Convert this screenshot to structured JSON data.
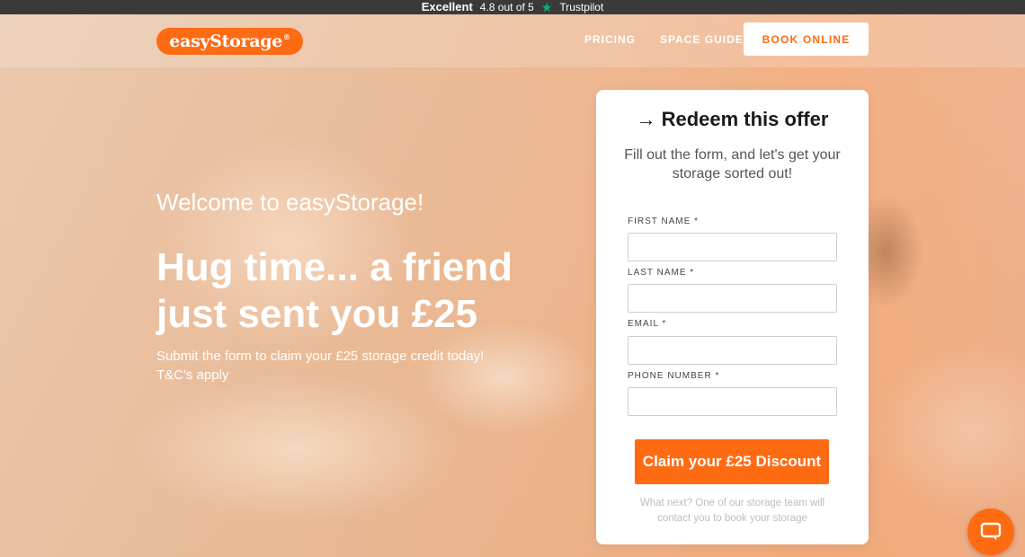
{
  "trustbar": {
    "rating_word": "Excellent",
    "rating_score": "4.8 out of 5",
    "star_icon": "star-icon",
    "brand": "Trustpilot"
  },
  "header": {
    "logo_text": "easyStorage",
    "logo_mark": "®",
    "nav": {
      "pricing": "PRICING",
      "space_guide": "SPACE GUIDE"
    },
    "book_button": "BOOK ONLINE"
  },
  "hero": {
    "welcome": "Welcome to easyStorage!",
    "headline": "Hug time... a friend just sent you £25",
    "subtext_line1": "Submit the form to claim your £25 storage credit today!",
    "subtext_line2": "T&C's apply"
  },
  "form": {
    "arrow_icon": "→",
    "title": "Redeem this offer",
    "subtitle": "Fill out the form, and let's get your storage sorted out!",
    "fields": {
      "first_name": {
        "label": "FIRST NAME *",
        "value": ""
      },
      "last_name": {
        "label": "LAST NAME *",
        "value": ""
      },
      "email": {
        "label": "EMAIL *",
        "value": ""
      },
      "phone": {
        "label": "PHONE NUMBER *",
        "value": ""
      }
    },
    "submit_label": "Claim your £25 Discount",
    "footnote": "What next? One of our storage team will contact you to book your storage"
  },
  "colors": {
    "brand_orange": "#ff6b13",
    "trustpilot_green": "#00b67a"
  },
  "chat_widget": {
    "icon": "chat-bubble-icon"
  }
}
